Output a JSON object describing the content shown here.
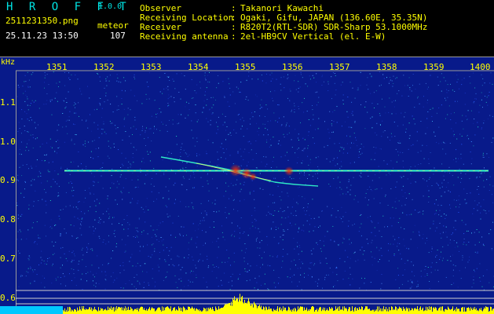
{
  "header": {
    "app_title": "H R O F F T",
    "app_version": "1.0.0",
    "file_name": "2511231350.png",
    "mode": "meteor",
    "datetime": "25.11.23 13:50",
    "count": "107",
    "info": [
      {
        "label": "Observer",
        "value": "Takanori Kawachi"
      },
      {
        "label": "Receiving Location",
        "value": "Ogaki, Gifu, JAPAN (136.60E, 35.35N)"
      },
      {
        "label": "Receiver",
        "value": "R820T2(RTL-SDR) SDR-Sharp 53.1000MHz"
      },
      {
        "label": "Receiving antenna",
        "value": "2el-HB9CV Vertical (el. E-W)"
      }
    ]
  },
  "spectrogram": {
    "unit": "kHz",
    "x_ticks": [
      "1351",
      "1352",
      "1353",
      "1354",
      "1355",
      "1356",
      "1357",
      "1358",
      "1359",
      "1400"
    ],
    "y_ticks": [
      "1.1",
      "1.0",
      "0.9",
      "0.8",
      "0.7",
      "0.6"
    ],
    "y_ticks_all": [
      "1.1",
      "1.0",
      "0.9",
      "0.8",
      "0.7",
      "0.6"
    ],
    "carrier_khz": 0.92,
    "colors": {
      "background": "#081a8a",
      "text": "#ffff00",
      "carrier": "#33ffcc",
      "baseline": "#00c8ff",
      "activity": "#ffff00"
    }
  }
}
